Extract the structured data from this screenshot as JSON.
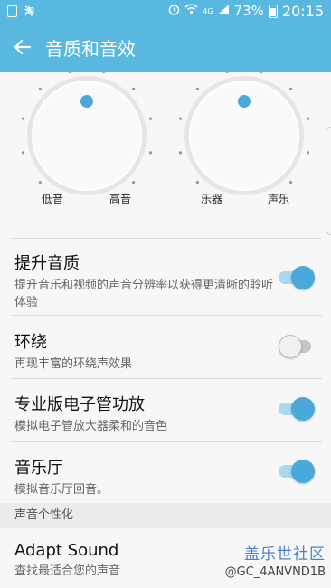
{
  "status_bar": {
    "app_glyph": "淘",
    "network": "4G",
    "battery": "73%",
    "time": "20:15"
  },
  "app_bar": {
    "title": "音质和音效"
  },
  "dials": {
    "left": {
      "min_label": "低音",
      "max_label": "高音",
      "level": 0.5
    },
    "right": {
      "min_label": "乐器",
      "max_label": "声乐",
      "level": 0.5
    }
  },
  "settings": [
    {
      "title": "提升音质",
      "subtitle": "提升音乐和视频的声音分辨率以获得更清晰的聆听体验",
      "enabled": true
    },
    {
      "title": "环绕",
      "subtitle": "再现丰富的环绕声效果",
      "enabled": false
    },
    {
      "title": "专业版电子管功放",
      "subtitle": "模拟电子管放大器柔和的音色",
      "enabled": true
    },
    {
      "title": "音乐厅",
      "subtitle": "模拟音乐厅回音。",
      "enabled": true
    }
  ],
  "section": {
    "header": "声音个性化",
    "item_title": "Adapt Sound",
    "item_subtitle": "查找最适合您的声音"
  },
  "watermark": {
    "name": "盖乐世社区",
    "handle": "@GC_4ANVND1B"
  },
  "colors": {
    "accent": "#59b8e0",
    "toggle_on": "#4aa9db"
  }
}
